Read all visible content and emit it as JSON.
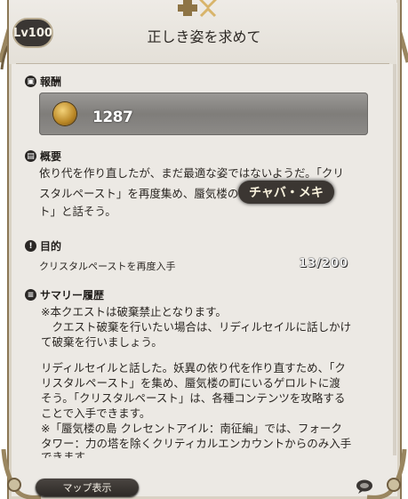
{
  "header": {
    "level_badge": "Lv100",
    "title": "正しき姿を求めて"
  },
  "reward": {
    "heading": "報酬",
    "gil_amount": "1287"
  },
  "summary": {
    "heading": "概要",
    "line1": "依り代を作り直したが、まだ最適な姿ではないようだ。「クリ",
    "line2a": "スタルペースト」を再度集め、蜃気楼の",
    "line2b": "",
    "line3": "ト」と話そう。"
  },
  "npc_tag": "チャバ・メキ",
  "objective": {
    "heading": "目的",
    "text": "クリスタルペーストを再度入手",
    "count": "13/200"
  },
  "history": {
    "heading": "サマリー履歴",
    "p1_l1": "※本クエストは破棄禁止となります。",
    "p1_l2": "　クエスト破棄を行いたい場合は、リディルセイルに話しかけ",
    "p1_l3": "て破棄を行いましょう。",
    "p2_l1": "リディルセイルと話した。妖異の依り代を作り直すため、「ク",
    "p2_l2": "リスタルペースト」を集め、蜃気楼の町にいるゲロルトに渡",
    "p2_l3": "そう。「クリスタルペースト」は、各種コンテンツを攻略する",
    "p2_l4": "ことで入手できます。",
    "p2_l5": "※「蜃気楼の島 クレセントアイル：南征編」では、フォーク",
    "p2_l6": "タワー：力の塔を除くクリティカルエンカウントからのみ入手",
    "p2_l7": "できます。"
  },
  "footer": {
    "map_button": "マップ表示"
  },
  "colors": {
    "parchment": "#ece9e4",
    "frame_gold": "#8b7755",
    "highlight": "#b27412",
    "dark_button": "#2e2a27"
  },
  "icons": [
    "reward-icon",
    "summary-icon",
    "objective-icon",
    "history-icon",
    "chat-bubble-icon",
    "plus-key-crest-icon"
  ]
}
